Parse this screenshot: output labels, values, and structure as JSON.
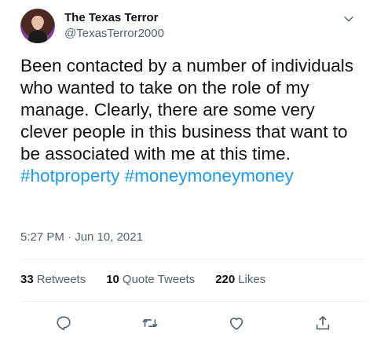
{
  "user": {
    "display_name": "The Texas Terror",
    "handle": "@TexasTerror2000"
  },
  "tweet": {
    "text": "Been contacted by a number of individuals who wanted to take on the role of my manage. Clearly, there are some very clever people in this business that want to be associated with me at this time.",
    "hashtags": [
      "#hotproperty",
      "#moneymoneymoney"
    ],
    "timestamp": "5:27 PM · Jun 10, 2021"
  },
  "stats": {
    "retweets_count": "33",
    "retweets_label": "Retweets",
    "quotes_count": "10",
    "quotes_label": "Quote Tweets",
    "likes_count": "220",
    "likes_label": "Likes"
  },
  "colors": {
    "text": "#0f1419",
    "secondary": "#536471",
    "link": "#1d9bf0",
    "divider": "#eff3f4"
  },
  "icons": {
    "more": "chevron-down-icon",
    "reply": "reply-icon",
    "retweet": "retweet-icon",
    "like": "heart-icon",
    "share": "share-icon"
  }
}
